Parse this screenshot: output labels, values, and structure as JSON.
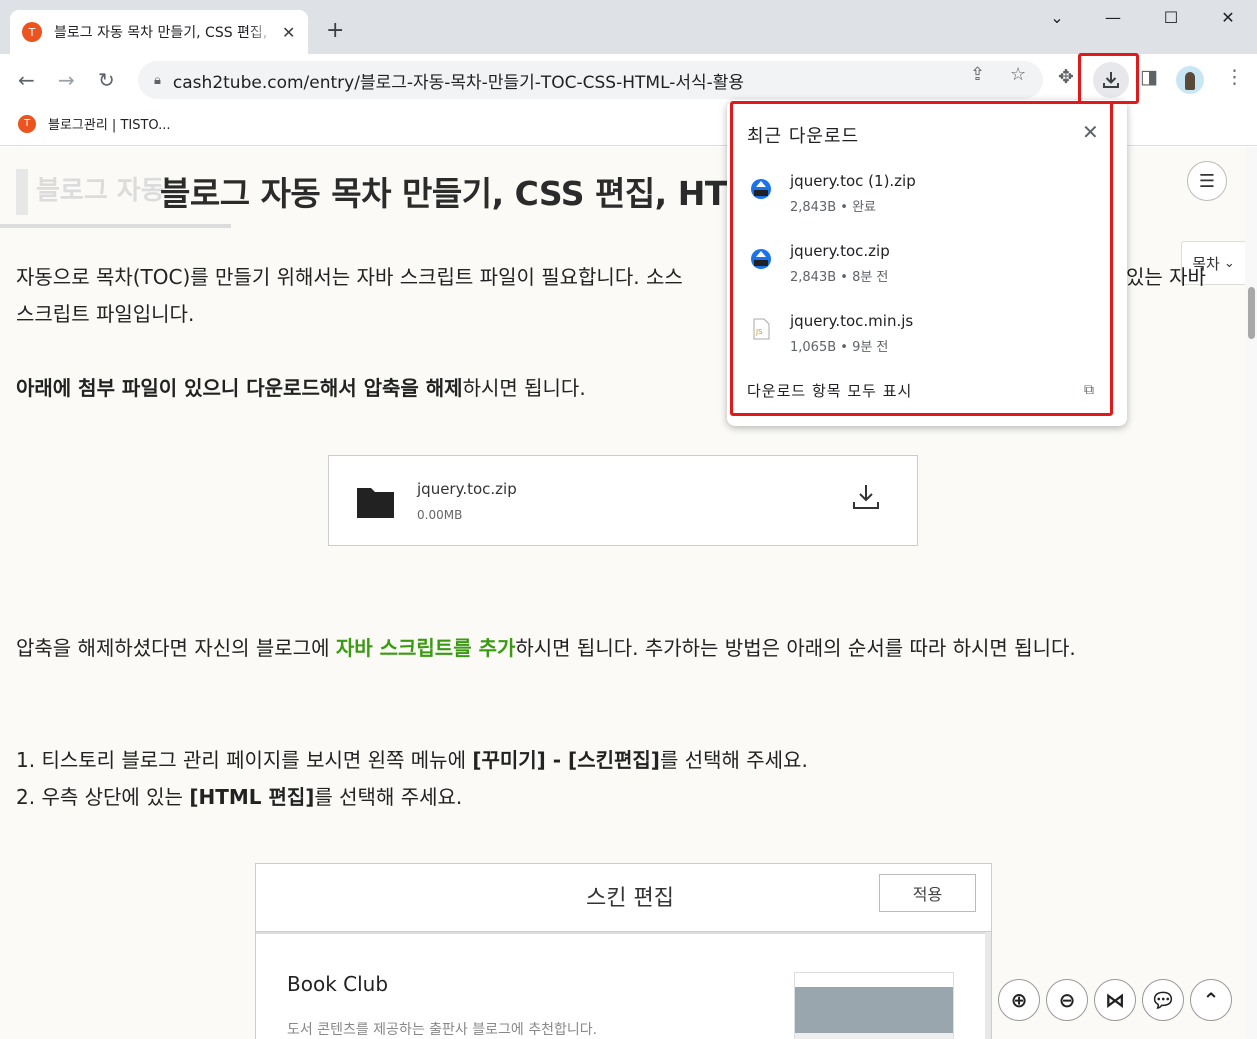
{
  "browser": {
    "tab": {
      "favicon": "T",
      "title": "블로그 자동 목차 만들기, CSS 편집, HTML 서식 활용"
    },
    "new_tab": "+",
    "url": "cash2tube.com/entry/블로그-자동-목차-만들기-TOC-CSS-HTML-서식-활용",
    "bookmark": {
      "favicon": "T",
      "label": "블로그관리 | TISTO..."
    }
  },
  "article": {
    "ghost_title": "블로그 자동",
    "title": "블로그 자동 목차 만들기, CSS 편집, HT",
    "toc_tab": "목차",
    "p1_line1": "자동으로 목차(TOC)를 만들기 위해서는 자바 스크립트 파일이 필요합니다. 소스",
    "p1_line1_tail": "있는 자바",
    "p1_line2": "스크립트 파일입니다.",
    "p2_bold": "아래에 첨부 파일이 있으니 다운로드해서 압축을 해제",
    "p2_rest": "하시면 됩니다.",
    "attachment": {
      "name": "jquery.toc.zip",
      "size": "0.00MB"
    },
    "p3_a": "압축을 해제하셨다면 자신의 블로그에 ",
    "p3_green": "자바 스크립트를 추가",
    "p3_b": "하시면 됩니다. 추가하는 방법은 아래의 순서를 따라 하시면 됩니다.",
    "step1_a": "1. 티스토리 블로그 관리 페이지를 보시면 왼쪽 메뉴에 ",
    "step1_b": "[꾸미기] - [스킨편집]",
    "step1_c": "를 선택해 주세요.",
    "step2_a": "2. 우측 상단에 있는 ",
    "step2_b": "[HTML 편집]",
    "step2_c": "를 선택해 주세요.",
    "skin": {
      "title": "스킨 편집",
      "apply": "적용",
      "blog_name": "Book Club",
      "blog_desc": "도서 콘텐츠를 제공하는 출판사 블로그에 추천합니다."
    }
  },
  "downloads": {
    "title": "최근 다운로드",
    "items": [
      {
        "name": "jquery.toc (1).zip",
        "status": "2,843B • 완료",
        "icon": "zip-file-icon"
      },
      {
        "name": "jquery.toc.zip",
        "status": "2,843B • 8분 전",
        "icon": "zip-file-icon"
      },
      {
        "name": "jquery.toc.min.js",
        "status": "1,065B • 9분 전",
        "icon": "js-file-icon"
      }
    ],
    "show_all": "다운로드 항목 모두 표시"
  },
  "colors": {
    "highlight": "#e01a1a",
    "accent_green": "#3a9a12",
    "favicon": "#eb531f"
  }
}
